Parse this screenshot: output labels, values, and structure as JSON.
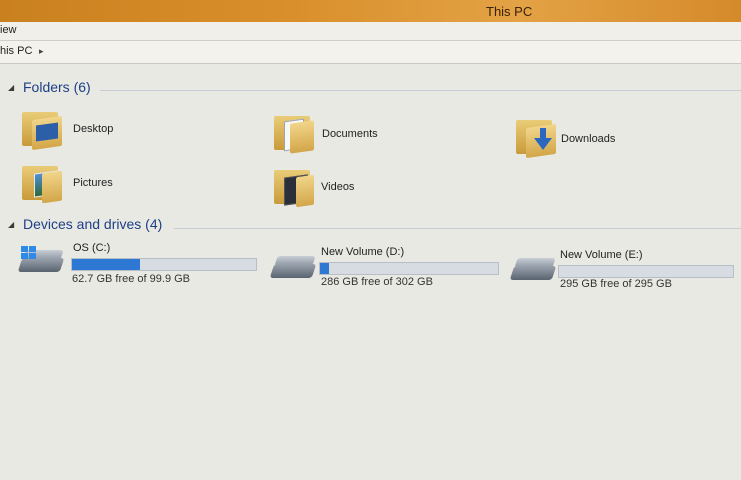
{
  "window": {
    "title": "This PC"
  },
  "menu": {
    "item": "iew"
  },
  "address": {
    "crumb": "his PC",
    "separator": "▸"
  },
  "folders": {
    "header": "Folders (6)",
    "items": [
      {
        "name": "Desktop",
        "icon": "desktop-folder-icon"
      },
      {
        "name": "Documents",
        "icon": "documents-folder-icon"
      },
      {
        "name": "Downloads",
        "icon": "downloads-folder-icon"
      },
      {
        "name": "Pictures",
        "icon": "pictures-folder-icon"
      },
      {
        "name": "Videos",
        "icon": "videos-folder-icon"
      }
    ]
  },
  "drives": {
    "header": "Devices and drives (4)",
    "items": [
      {
        "name": "OS (C:)",
        "free_text": "62.7 GB free of 99.9 GB",
        "used_fraction": 0.372,
        "icon": "windows-drive-icon"
      },
      {
        "name": "New Volume (D:)",
        "free_text": "286 GB free of 302 GB",
        "used_fraction": 0.053,
        "icon": "hard-drive-icon"
      },
      {
        "name": "New Volume (E:)",
        "free_text": "295 GB free of 295 GB",
        "used_fraction": 0.0,
        "icon": "hard-drive-icon"
      }
    ]
  },
  "colors": {
    "accent": "#2c78d2",
    "header_text": "#1d3f86"
  }
}
